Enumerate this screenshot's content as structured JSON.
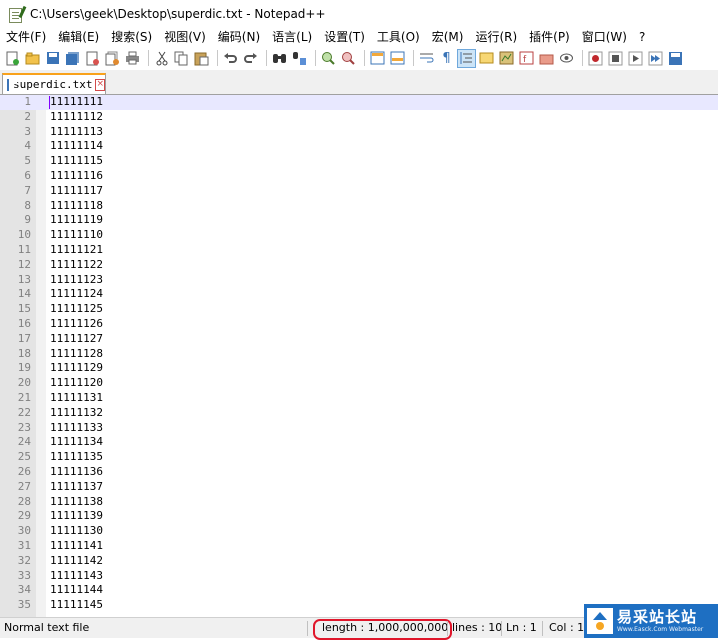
{
  "window": {
    "title": "C:\\Users\\geek\\Desktop\\superdic.txt - Notepad++"
  },
  "menu": [
    "文件(F)",
    "编辑(E)",
    "搜索(S)",
    "视图(V)",
    "编码(N)",
    "语言(L)",
    "设置(T)",
    "工具(O)",
    "宏(M)",
    "运行(R)",
    "插件(P)",
    "窗口(W)",
    "?"
  ],
  "toolbar": {
    "icons": [
      "new-file",
      "open-file",
      "save",
      "save-all",
      "close",
      "close-all",
      "print",
      "cut",
      "copy",
      "paste",
      "undo",
      "redo",
      "find",
      "replace",
      "zoom-in",
      "zoom-out",
      "sync-vertical",
      "sync-horizontal",
      "word-wrap",
      "show-all-chars",
      "indent-guide",
      "user-defined-language",
      "document-map",
      "function-list",
      "folder-as-workspace",
      "monitoring",
      "record-macro",
      "stop-record",
      "play-macro",
      "run-macro-multiple",
      "save-macro"
    ]
  },
  "tab": {
    "name": "superdic.txt"
  },
  "editor": {
    "lines": [
      {
        "n": "1",
        "t": "11111111"
      },
      {
        "n": "2",
        "t": "11111112"
      },
      {
        "n": "3",
        "t": "11111113"
      },
      {
        "n": "4",
        "t": "11111114"
      },
      {
        "n": "5",
        "t": "11111115"
      },
      {
        "n": "6",
        "t": "11111116"
      },
      {
        "n": "7",
        "t": "11111117"
      },
      {
        "n": "8",
        "t": "11111118"
      },
      {
        "n": "9",
        "t": "11111119"
      },
      {
        "n": "10",
        "t": "11111110"
      },
      {
        "n": "11",
        "t": "11111121"
      },
      {
        "n": "12",
        "t": "11111122"
      },
      {
        "n": "13",
        "t": "11111123"
      },
      {
        "n": "14",
        "t": "11111124"
      },
      {
        "n": "15",
        "t": "11111125"
      },
      {
        "n": "16",
        "t": "11111126"
      },
      {
        "n": "17",
        "t": "11111127"
      },
      {
        "n": "18",
        "t": "11111128"
      },
      {
        "n": "19",
        "t": "11111129"
      },
      {
        "n": "20",
        "t": "11111120"
      },
      {
        "n": "21",
        "t": "11111131"
      },
      {
        "n": "22",
        "t": "11111132"
      },
      {
        "n": "23",
        "t": "11111133"
      },
      {
        "n": "24",
        "t": "11111134"
      },
      {
        "n": "25",
        "t": "11111135"
      },
      {
        "n": "26",
        "t": "11111136"
      },
      {
        "n": "27",
        "t": "11111137"
      },
      {
        "n": "28",
        "t": "11111138"
      },
      {
        "n": "29",
        "t": "11111139"
      },
      {
        "n": "30",
        "t": "11111130"
      },
      {
        "n": "31",
        "t": "11111141"
      },
      {
        "n": "32",
        "t": "11111142"
      },
      {
        "n": "33",
        "t": "11111143"
      },
      {
        "n": "34",
        "t": "11111144"
      },
      {
        "n": "35",
        "t": "11111145"
      }
    ]
  },
  "status": {
    "file_type": "Normal text file",
    "length": "length : 1,000,000,000",
    "lines": "lines : 10(",
    "ln": "Ln : 1",
    "col": "Col : 1"
  },
  "watermark": {
    "cn": "易采站长站",
    "en": "Www.Easck.Com Webmaster"
  },
  "colors": {
    "highlight_border": "#e0162b",
    "tab_accent": "#f9a21b",
    "current_line": "#e8e8ff",
    "watermark_bg": "#1e6fc2"
  }
}
